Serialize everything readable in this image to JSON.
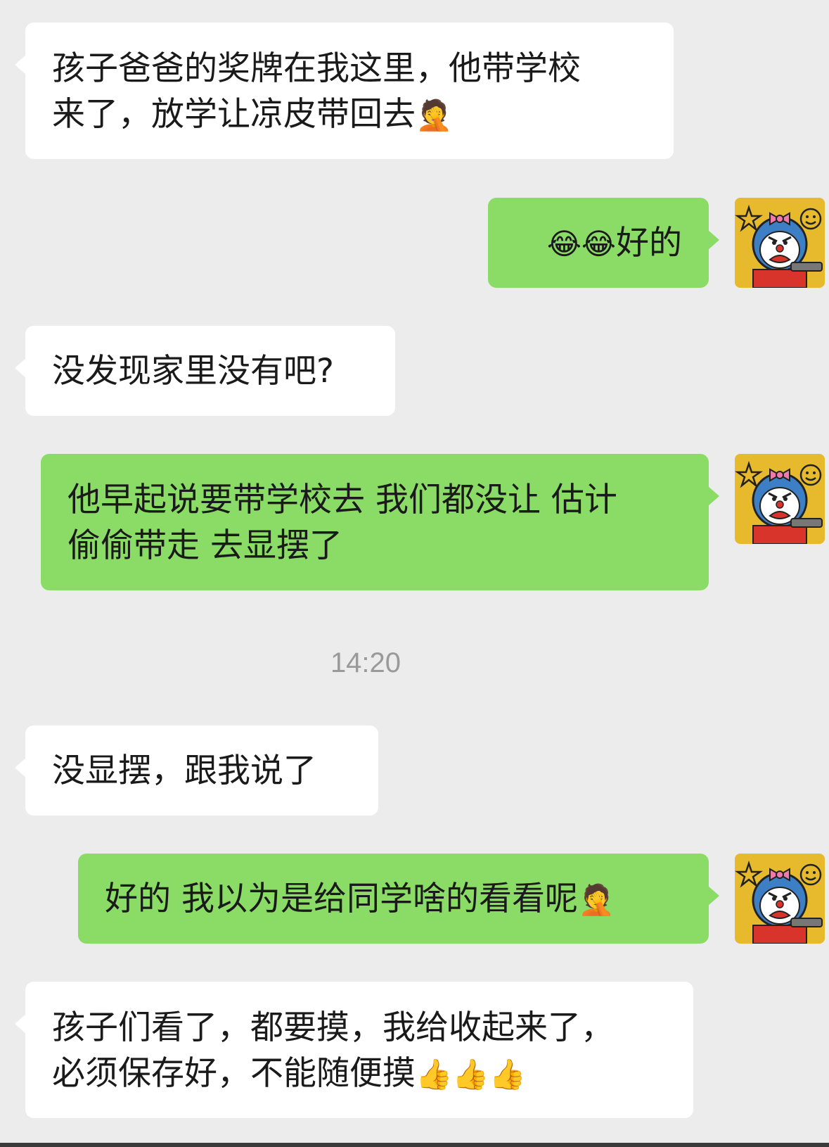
{
  "messages": [
    {
      "id": "m1",
      "side": "incoming",
      "lines": [
        "孩子爸爸的奖牌在我这里，他带学校",
        "来了，放学让凉皮带回去"
      ],
      "trailing_emoji": "🤦",
      "trailing_emoji_name": "facepalm-emoji"
    },
    {
      "id": "m2",
      "side": "outgoing",
      "leading_emojis": "😂😂",
      "text": "好的"
    },
    {
      "id": "m3",
      "side": "incoming",
      "text": "没发现家里没有吧?"
    },
    {
      "id": "m4",
      "side": "outgoing",
      "lines": [
        "他早起说要带学校去 我们都没让 估计",
        "偷偷带走 去显摆了"
      ]
    },
    {
      "id": "m5",
      "side": "incoming",
      "text": "没显摆，跟我说了"
    },
    {
      "id": "m6",
      "side": "outgoing",
      "text": "好的 我以为是给同学啥的看看呢",
      "trailing_emoji": "🤦",
      "trailing_emoji_name": "facepalm-emoji"
    },
    {
      "id": "m7",
      "side": "incoming",
      "lines": [
        "孩子们看了，都要摸，我给收起来了，",
        "必须保存好，不能随便摸"
      ],
      "trailing_emoji": "👍👍👍",
      "trailing_emoji_name": "thumbs-up-emoji"
    }
  ],
  "timestamp": "14:20",
  "avatar": {
    "icon": "cartoon-avatar-icon",
    "colors": {
      "background": "#e7b92d",
      "face_blue": "#3d7fc4",
      "bow_pink": "#f07aa8",
      "outfit_red": "#d8342c"
    }
  },
  "colors": {
    "chat_background": "#ececec",
    "incoming_bubble": "#ffffff",
    "outgoing_bubble": "#8bdc66",
    "timestamp_text": "#9a9a9a"
  }
}
